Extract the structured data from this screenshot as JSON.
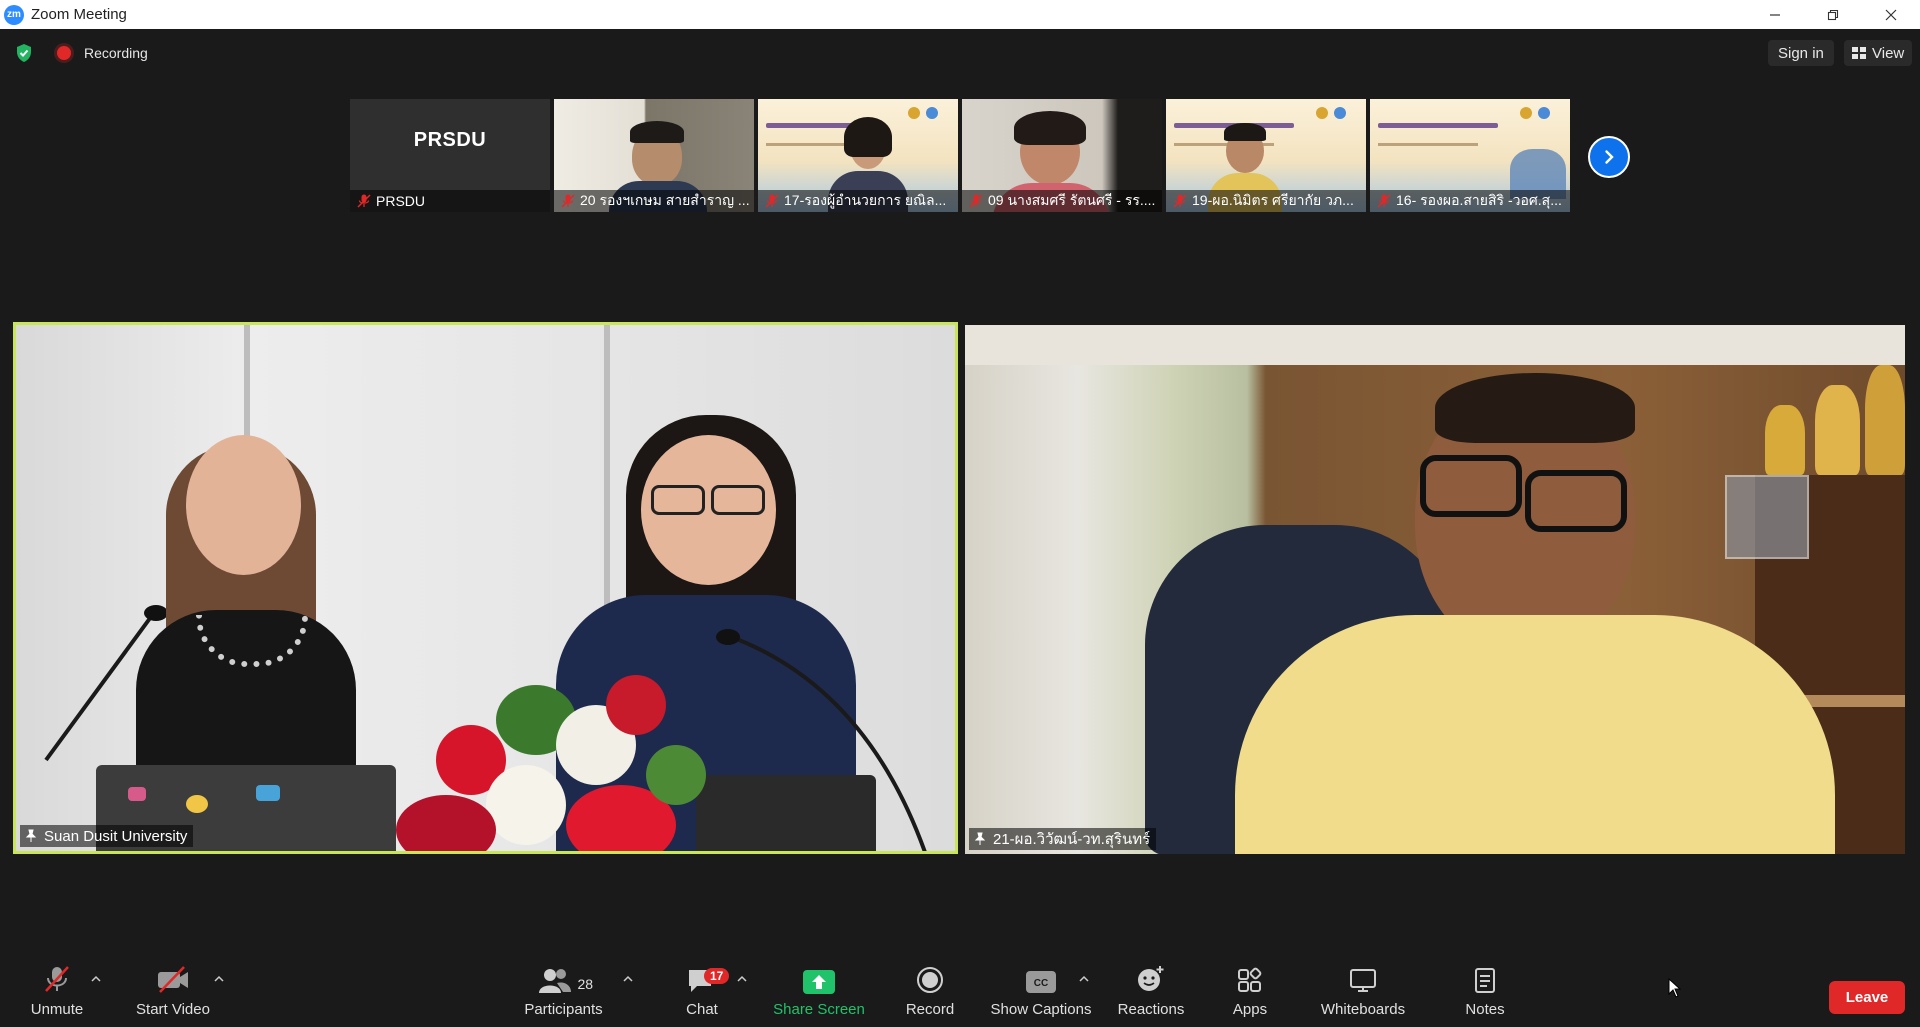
{
  "window": {
    "title": "Zoom Meeting",
    "logo": "zm"
  },
  "topbar": {
    "recording_label": "Recording",
    "signin_label": "Sign in",
    "view_label": "View"
  },
  "thumbnails": [
    {
      "name": "PRSDU",
      "center_text": "PRSDU"
    },
    {
      "name": "20 รองฯเกษม สายสำราญ ..."
    },
    {
      "name": "17-รองผู้อำนวยการ ยณิล..."
    },
    {
      "name": "09 นางสมศรี รัตนศรี - รร...."
    },
    {
      "name": "19-ผอ.นิมิตร ศรียากัย วภ..."
    },
    {
      "name": "16- รองผอ.สายสิริ -วอศ.สุ..."
    }
  ],
  "main_videos": [
    {
      "name": "Suan Dusit University"
    },
    {
      "name": "21-ผอ.วิวัฒน์-วท.สุรินทร์"
    }
  ],
  "toolbar": {
    "unmute": "Unmute",
    "start_video": "Start Video",
    "participants": "Participants",
    "participants_count": "28",
    "chat": "Chat",
    "chat_badge": "17",
    "share_screen": "Share Screen",
    "record": "Record",
    "show_captions": "Show Captions",
    "reactions": "Reactions",
    "apps": "Apps",
    "whiteboards": "Whiteboards",
    "notes": "Notes",
    "leave": "Leave"
  },
  "colors": {
    "accent": "#0e72ed",
    "active_speaker": "#c9e65a",
    "leave": "#e02828",
    "share": "#20c26a"
  }
}
